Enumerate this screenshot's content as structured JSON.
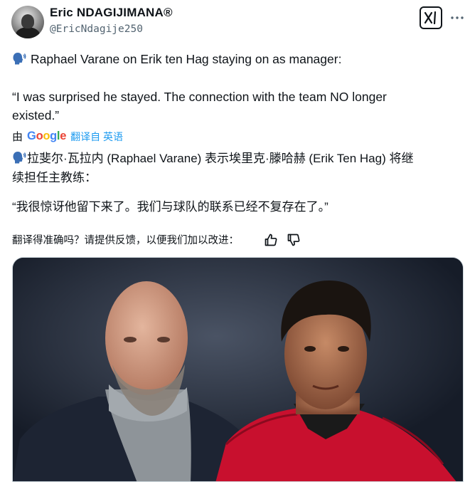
{
  "author": {
    "name": "Eric NDAGIJIMANA®",
    "handle": "@EricNdagije250"
  },
  "icons": {
    "avatar": "avatar",
    "grok": "grok-icon",
    "more": "more-icon",
    "speaking_head": "speaking-head-emoji",
    "thumbs_up": "thumbs-up-icon",
    "thumbs_down": "thumbs-down-icon"
  },
  "tweet": {
    "line1": "Raphael Varane on Erik ten Hag staying on as manager:",
    "line2": "“I was surprised he stayed. The connection with the team NO longer",
    "line3": "existed.”"
  },
  "translation": {
    "by_prefix": "由",
    "google": "Google",
    "link": "翻译自 英语",
    "line1": "拉斐尔·瓦拉内 (Raphael Varane) 表示埃里克·滕哈赫 (Erik Ten Hag) 将继",
    "line2": "续担任主教练：",
    "line3": "“我很惊讶他留下来了。我们与球队的联系已经不复存在了。”"
  },
  "feedback": {
    "prompt": "翻译得准确吗？请提供反馈，以便我们加以改进："
  },
  "colors": {
    "text": "#0f1419",
    "secondary": "#536471",
    "link": "#1d9bf0",
    "man_utd_red": "#c8102e"
  }
}
